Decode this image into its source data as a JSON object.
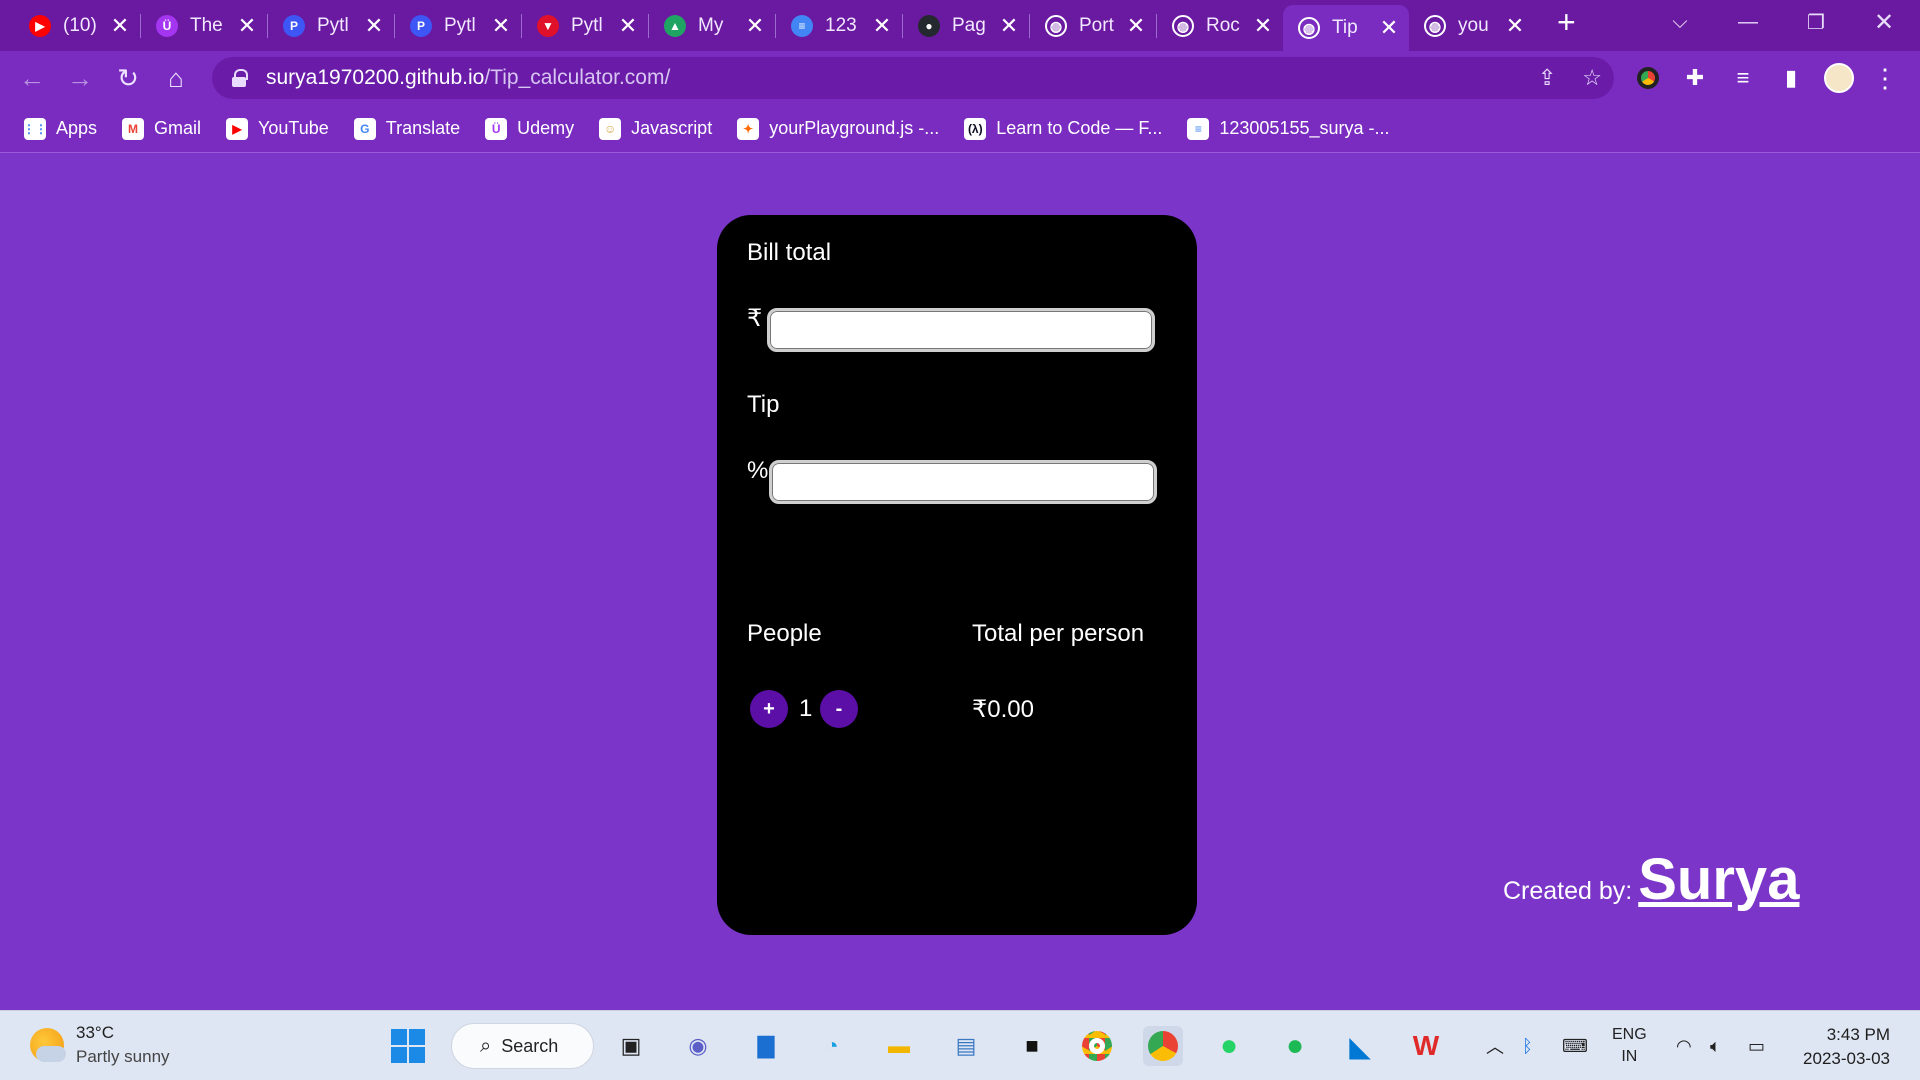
{
  "browser": {
    "tabs": [
      {
        "title": "(10)",
        "icon": "youtube-icon",
        "color": "#ff0000",
        "glyph": "▶"
      },
      {
        "title": "The",
        "icon": "udemy-icon",
        "color": "#a435f0",
        "glyph": "Ü"
      },
      {
        "title": "Pytl",
        "icon": "pycharm-icon",
        "color": "#3d56f5",
        "glyph": "P"
      },
      {
        "title": "Pytl",
        "icon": "pycharm-icon",
        "color": "#3d56f5",
        "glyph": "P"
      },
      {
        "title": "Pytl",
        "icon": "vercel-icon",
        "color": "#e0102a",
        "glyph": "▼"
      },
      {
        "title": "My",
        "icon": "google-drive-icon",
        "color": "#1fa463",
        "glyph": "▲"
      },
      {
        "title": "123",
        "icon": "google-docs-icon",
        "color": "#4285f4",
        "glyph": "≡"
      },
      {
        "title": "Pag",
        "icon": "github-icon",
        "color": "#24292f",
        "glyph": "●"
      },
      {
        "title": "Port",
        "icon": "globe-icon",
        "color": "#ffffff",
        "glyph": "◍"
      },
      {
        "title": "Roc",
        "icon": "globe-icon",
        "color": "#ffffff",
        "glyph": "◍"
      },
      {
        "title": "Tip",
        "icon": "globe-icon",
        "color": "#ffffff",
        "glyph": "◍",
        "active": true
      },
      {
        "title": "you",
        "icon": "globe-icon",
        "color": "#ffffff",
        "glyph": "◍"
      }
    ],
    "url_host": "surya1970200.github.io",
    "url_path": "/Tip_calculator.com/",
    "bookmarks": [
      {
        "label": "Apps",
        "icon": "apps-grid-icon",
        "color": "#4285f4",
        "glyph": "⋮⋮"
      },
      {
        "label": "Gmail",
        "icon": "gmail-icon",
        "color": "#ea4335",
        "glyph": "M"
      },
      {
        "label": "YouTube",
        "icon": "youtube-icon",
        "color": "#ff0000",
        "glyph": "▶"
      },
      {
        "label": "Translate",
        "icon": "google-translate-icon",
        "color": "#4285f4",
        "glyph": "G"
      },
      {
        "label": "Udemy",
        "icon": "udemy-icon",
        "color": "#a435f0",
        "glyph": "Ü"
      },
      {
        "label": "Javascript",
        "icon": "javascript-avatar-icon",
        "color": "#d9a441",
        "glyph": "☺"
      },
      {
        "label": "yourPlayground.js -...",
        "icon": "playground-icon",
        "color": "#ff6a00",
        "glyph": "✦"
      },
      {
        "label": "Learn to Code — F...",
        "icon": "freecodecamp-icon",
        "color": "#0a0a23",
        "glyph": "(λ)"
      },
      {
        "label": "123005155_surya -...",
        "icon": "google-docs-icon",
        "color": "#4285f4",
        "glyph": "≡"
      }
    ]
  },
  "app": {
    "bill_label": "Bill total",
    "currency_symbol": "₹",
    "bill_value": "",
    "tip_label": "Tip",
    "percent_symbol": "%",
    "tip_value": "",
    "people_label": "People",
    "total_label": "Total per person",
    "increment_label": "+",
    "decrement_label": "-",
    "people_count": "1",
    "total_value": "₹0.00",
    "created_by_label": "Created by:",
    "author": "Surya",
    "accent_color": "#5b0fa6"
  },
  "taskbar": {
    "temperature": "33°C",
    "condition": "Partly sunny",
    "search_label": "Search",
    "language_top": "ENG",
    "language_bottom": "IN",
    "time": "3:43 PM",
    "date": "2023-03-03"
  }
}
